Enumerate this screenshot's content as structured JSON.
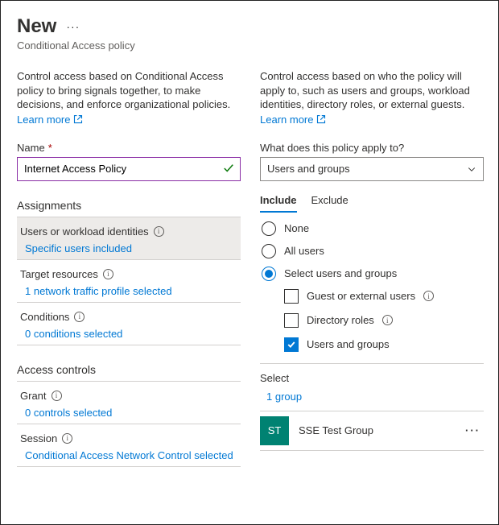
{
  "header": {
    "title": "New",
    "subtitle": "Conditional Access policy"
  },
  "left": {
    "description": "Control access based on Conditional Access policy to bring signals together, to make decisions, and enforce organizational policies.",
    "learn_more": "Learn more",
    "name_label": "Name",
    "name_value": "Internet Access Policy",
    "assignments_title": "Assignments",
    "rows": {
      "users": {
        "label": "Users or workload identities",
        "value": "Specific users included"
      },
      "target": {
        "label": "Target resources",
        "value": "1 network traffic profile selected"
      },
      "conditions": {
        "label": "Conditions",
        "value": "0 conditions selected"
      }
    },
    "access_controls_title": "Access controls",
    "grant": {
      "label": "Grant",
      "value": "0 controls selected"
    },
    "session": {
      "label": "Session",
      "value": "Conditional Access Network Control selected"
    }
  },
  "right": {
    "description": "Control access based on who the policy will apply to, such as users and groups, workload identities, directory roles, or external guests.",
    "learn_more": "Learn more",
    "apply_label": "What does this policy apply to?",
    "apply_value": "Users and groups",
    "tabs": {
      "include": "Include",
      "exclude": "Exclude"
    },
    "radios": {
      "none": "None",
      "all": "All users",
      "select": "Select users and groups"
    },
    "checks": {
      "guest": "Guest or external users",
      "roles": "Directory roles",
      "users": "Users and groups"
    },
    "select_label": "Select",
    "select_value": "1 group",
    "group": {
      "initials": "ST",
      "name": "SSE Test Group"
    }
  }
}
